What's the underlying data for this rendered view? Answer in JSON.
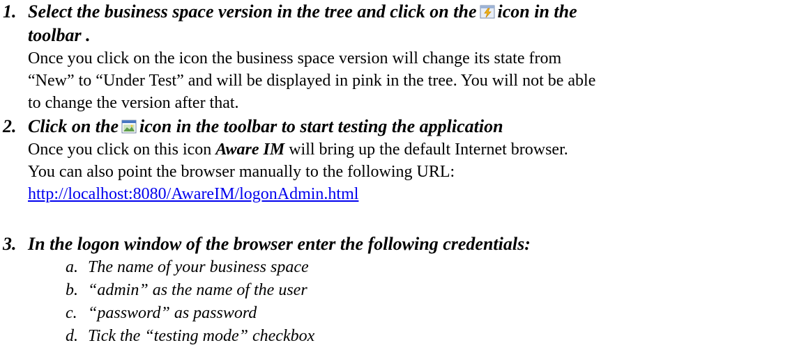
{
  "steps": [
    {
      "number": "1.",
      "heading_before_icon": "Select the business space version in the tree and click on the",
      "heading_icon": "put-under-test-icon",
      "heading_after_icon": "icon in the",
      "heading_line2": "toolbar .",
      "body_lines": [
        "Once you click on the icon the business space version will change its state from",
        "“New” to “Under Test” and will be displayed in pink in the tree. You will not be able",
        "to change the version after that."
      ]
    },
    {
      "number": "2.",
      "heading_before_icon": "Click on the",
      "heading_icon": "start-testing-icon",
      "heading_after_icon": "icon in the toolbar to start testing the application",
      "body_line1_before": "Once you click on this icon ",
      "body_line1_emphasis": "Aware IM",
      "body_line1_after": " will bring up the default Internet browser.",
      "body_line2": "You can also point the browser manually to the following URL:",
      "url": "http://localhost:8080/AwareIM/logonAdmin.html"
    },
    {
      "number": "3.",
      "heading": "In the logon window of the browser enter the following credentials:",
      "subitems": [
        {
          "letter": "a.",
          "text": "The name of your business space"
        },
        {
          "letter": "b.",
          "text": "“admin” as the name of the user"
        },
        {
          "letter": "c.",
          "text": "“password” as password"
        },
        {
          "letter": "d.",
          "text": "Tick the “testing mode” checkbox"
        }
      ]
    }
  ]
}
